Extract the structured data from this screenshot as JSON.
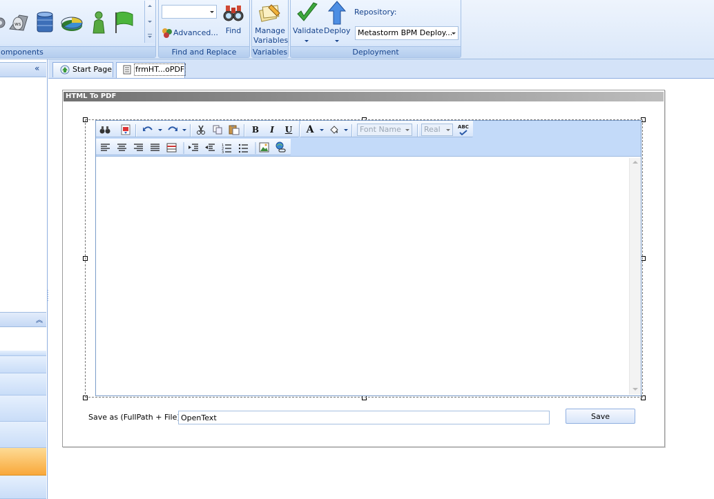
{
  "ribbon": {
    "components_group": {
      "caption": "omponents",
      "icons": [
        "gear-icon",
        "web-service-icon",
        "database-icon",
        "pie-chart-icon",
        "person-icon",
        "flag-icon"
      ]
    },
    "find_replace_group": {
      "caption": "Find and Replace",
      "advanced_label": "Advanced...",
      "find_label": "Find",
      "search_value": ""
    },
    "variables_group": {
      "caption": "Variables",
      "manage_label": "Manage\nVariables"
    },
    "deployment_group": {
      "caption": "Deployment",
      "validate_label": "Validate",
      "deploy_label": "Deploy",
      "repository_label": "Repository:",
      "repository_value": "Metastorm BPM Deploy..."
    }
  },
  "left_panel": {
    "collapse_glyph": "«",
    "expand_glyph": "︽"
  },
  "tabs": [
    {
      "label": "Start Page",
      "icon": "start-page-icon"
    },
    {
      "label": "frmHT...oPDF",
      "icon": "form-icon"
    }
  ],
  "form": {
    "title": "HTML To PDF",
    "editor": {
      "font_name": "Font Name",
      "font_size": "Real",
      "toolbar1": [
        "find-icon",
        "pdf-icon",
        "undo-icon",
        "redo-icon",
        "cut-icon",
        "copy-icon",
        "paste-icon",
        "bold-icon",
        "italic-icon",
        "underline-icon",
        "font-color-icon",
        "highlight-icon",
        "spellcheck-icon"
      ],
      "toolbar2": [
        "align-left-icon",
        "align-center-icon",
        "align-right-icon",
        "justify-icon",
        "horizontal-rule-icon",
        "indent-icon",
        "outdent-icon",
        "numbered-list-icon",
        "bullet-list-icon",
        "image-icon",
        "link-icon"
      ],
      "glyphs": {
        "bold": "B",
        "italic": "I",
        "underline": "U",
        "font_color": "A",
        "abc": "ABC"
      }
    },
    "save_as_label": "Save as (FullPath + File)",
    "save_as_value": "OpenText",
    "save_button_label": "Save"
  }
}
